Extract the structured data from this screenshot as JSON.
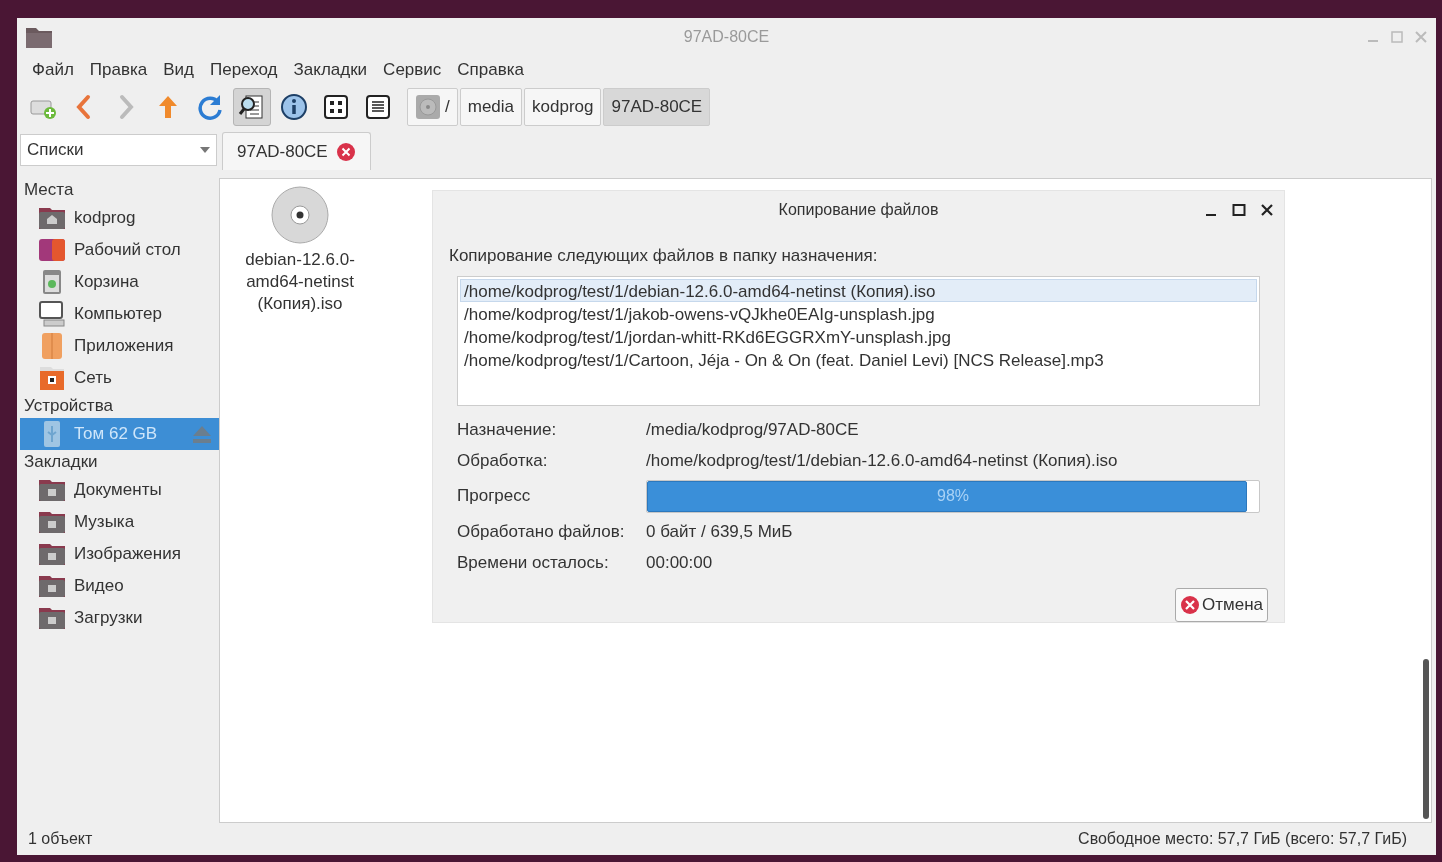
{
  "window": {
    "title": "97AD-80CE"
  },
  "menu": [
    "Файл",
    "Правка",
    "Вид",
    "Переход",
    "Закладки",
    "Сервис",
    "Справка"
  ],
  "toolbar": [
    {
      "kind": "new-tab",
      "pressed": false,
      "disabled": false
    },
    {
      "kind": "back",
      "pressed": false,
      "disabled": false
    },
    {
      "kind": "forward",
      "pressed": false,
      "disabled": true
    },
    {
      "kind": "up",
      "pressed": false,
      "disabled": false
    },
    {
      "kind": "reload",
      "pressed": false,
      "disabled": false
    },
    {
      "kind": "preview",
      "pressed": true,
      "disabled": false
    },
    {
      "kind": "info",
      "pressed": false,
      "disabled": false
    },
    {
      "kind": "icons",
      "pressed": false,
      "disabled": false
    },
    {
      "kind": "list",
      "pressed": false,
      "disabled": false
    }
  ],
  "path_bar": [
    {
      "kind": "root",
      "label": "/",
      "selected": false
    },
    {
      "kind": "dir",
      "label": "media",
      "selected": false
    },
    {
      "kind": "dir",
      "label": "kodprog",
      "selected": false
    },
    {
      "kind": "dir",
      "label": "97AD-80CE",
      "selected": true
    }
  ],
  "side_pane_mode": "Списки",
  "tabs": [
    {
      "label": "97AD-80CE",
      "selected": true
    }
  ],
  "sidebar": [
    {
      "title": "Места",
      "items": [
        {
          "kind": "home",
          "label": "kodprog",
          "selected": false,
          "eject": false
        },
        {
          "kind": "desktop",
          "label": "Рабочий стол",
          "selected": false,
          "eject": false
        },
        {
          "kind": "trash",
          "label": "Корзина",
          "selected": false,
          "eject": false
        },
        {
          "kind": "computer",
          "label": "Компьютер",
          "selected": false,
          "eject": false
        },
        {
          "kind": "apps",
          "label": "Приложения",
          "selected": false,
          "eject": false
        },
        {
          "kind": "network",
          "label": "Сеть",
          "selected": false,
          "eject": false
        }
      ]
    },
    {
      "title": "Устройства",
      "items": [
        {
          "kind": "usb",
          "label": "Том 62 GB",
          "selected": true,
          "eject": true
        }
      ]
    },
    {
      "title": "Закладки",
      "items": [
        {
          "kind": "folder",
          "label": "Документы",
          "selected": false,
          "eject": false
        },
        {
          "kind": "folder",
          "label": "Музыка",
          "selected": false,
          "eject": false
        },
        {
          "kind": "folder",
          "label": "Изображения",
          "selected": false,
          "eject": false
        },
        {
          "kind": "folder",
          "label": "Видео",
          "selected": false,
          "eject": false
        },
        {
          "kind": "folder",
          "label": "Загрузки",
          "selected": false,
          "eject": false
        }
      ]
    }
  ],
  "files": [
    {
      "kind": "disc-image",
      "name": "debian-12.6.0-amd64-netinst (Копия).iso"
    }
  ],
  "dialog": {
    "title": "Копирование файлов",
    "message": "Копирование следующих файлов в папку назначения:",
    "sources": [
      {
        "path": "/home/kodprog/test/1/debian-12.6.0-amd64-netinst (Копия).iso",
        "selected": true
      },
      {
        "path": "/home/kodprog/test/1/jakob-owens-vQJkhe0EAIg-unsplash.jpg",
        "selected": false
      },
      {
        "path": "/home/kodprog/test/1/jordan-whitt-RKd6EGGRXmY-unsplash.jpg",
        "selected": false
      },
      {
        "path": "/home/kodprog/test/1/Cartoon, Jéja - On & On (feat. Daniel Levi) [NCS Release].mp3",
        "selected": false
      }
    ],
    "destination": {
      "label": "Назначение:",
      "value": "/media/kodprog/97AD-80CE"
    },
    "current": {
      "label": "Обработка:",
      "value": "/home/kodprog/test/1/debian-12.6.0-amd64-netinst (Копия).iso"
    },
    "progress": {
      "label": "Прогресс",
      "level": 0.98,
      "reading": "98%"
    },
    "processed": {
      "label": "Обработано файлов:",
      "value": "0 байт / 639,5 МиБ"
    },
    "remaining": {
      "label": "Времени осталось:",
      "value": "00:00:00"
    },
    "cancel_button": "Отмена"
  },
  "status_bar": {
    "left": "1 объект",
    "right": "Свободное место: 57,7 ГиБ (всего: 57,7 ГиБ)"
  }
}
